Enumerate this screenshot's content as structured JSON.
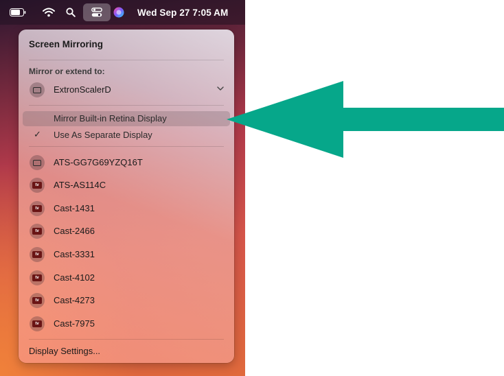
{
  "menubar": {
    "clock": "Wed Sep 27  7:05 AM",
    "icons": [
      "battery-icon",
      "wifi-icon",
      "search-icon",
      "control-center-icon",
      "siri-icon"
    ]
  },
  "panel": {
    "title": "Screen Mirroring",
    "section_label": "Mirror or extend to:",
    "selected_device": "ExtronScalerD",
    "options": [
      {
        "label": "Mirror Built-in Retina Display",
        "highlighted": true,
        "checked": false
      },
      {
        "label": "Use As Separate Display",
        "highlighted": false,
        "checked": true
      }
    ],
    "check_glyph": "✓",
    "devices": [
      {
        "name": "ATS-GG7G69YZQ16T",
        "icon": "display-icon"
      },
      {
        "name": "ATS-AS114C",
        "icon": "apple-tv-icon"
      },
      {
        "name": "Cast-1431",
        "icon": "apple-tv-icon"
      },
      {
        "name": "Cast-2466",
        "icon": "apple-tv-icon"
      },
      {
        "name": "Cast-3331",
        "icon": "apple-tv-icon"
      },
      {
        "name": "Cast-4102",
        "icon": "apple-tv-icon"
      },
      {
        "name": "Cast-4273",
        "icon": "apple-tv-icon"
      },
      {
        "name": "Cast-7975",
        "icon": "apple-tv-icon"
      }
    ],
    "footer": "Display Settings..."
  },
  "annotation": {
    "arrow_color": "#06a78a",
    "points_to": "Mirror Built-in Retina Display"
  },
  "colors": {
    "highlight": "#6e5f64",
    "apple_tv_badge": "#6a1515"
  }
}
